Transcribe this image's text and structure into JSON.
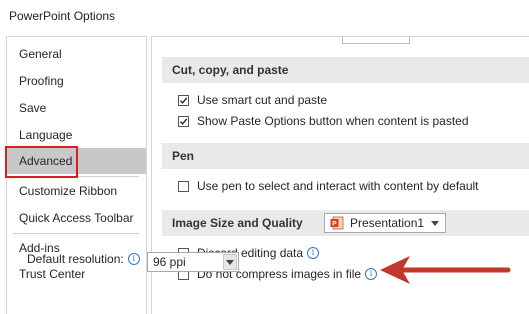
{
  "window": {
    "title": "PowerPoint Options"
  },
  "sidebar": {
    "items": [
      {
        "label": "General"
      },
      {
        "label": "Proofing"
      },
      {
        "label": "Save"
      },
      {
        "label": "Language"
      },
      {
        "label": "Advanced"
      },
      {
        "label": "Customize Ribbon"
      },
      {
        "label": "Quick Access Toolbar"
      },
      {
        "label": "Add-ins"
      },
      {
        "label": "Trust Center"
      }
    ],
    "selected": "Advanced"
  },
  "sections": {
    "cut_copy_paste": {
      "header": "Cut, copy, and paste",
      "options": [
        {
          "label": "Use smart cut and paste",
          "checked": true
        },
        {
          "label": "Show Paste Options button when content is pasted",
          "checked": true
        }
      ]
    },
    "pen": {
      "header": "Pen",
      "options": [
        {
          "label": "Use pen to select and interact with content by default",
          "checked": false
        }
      ]
    },
    "image": {
      "header": "Image Size and Quality",
      "document": "Presentation1",
      "options": [
        {
          "label": "Discard editing data",
          "checked": false
        },
        {
          "label": "Do not compress images in file",
          "checked": false
        }
      ],
      "resolution_label": "Default resolution:",
      "resolution_value": "96 ppi"
    }
  },
  "colors": {
    "highlight_box": "#d42020",
    "annotation_arrow": "#c0392b",
    "selected_item_bg": "#c8c8c8",
    "section_header_bg": "#e9e9e9",
    "info_icon": "#2b7ad6"
  }
}
